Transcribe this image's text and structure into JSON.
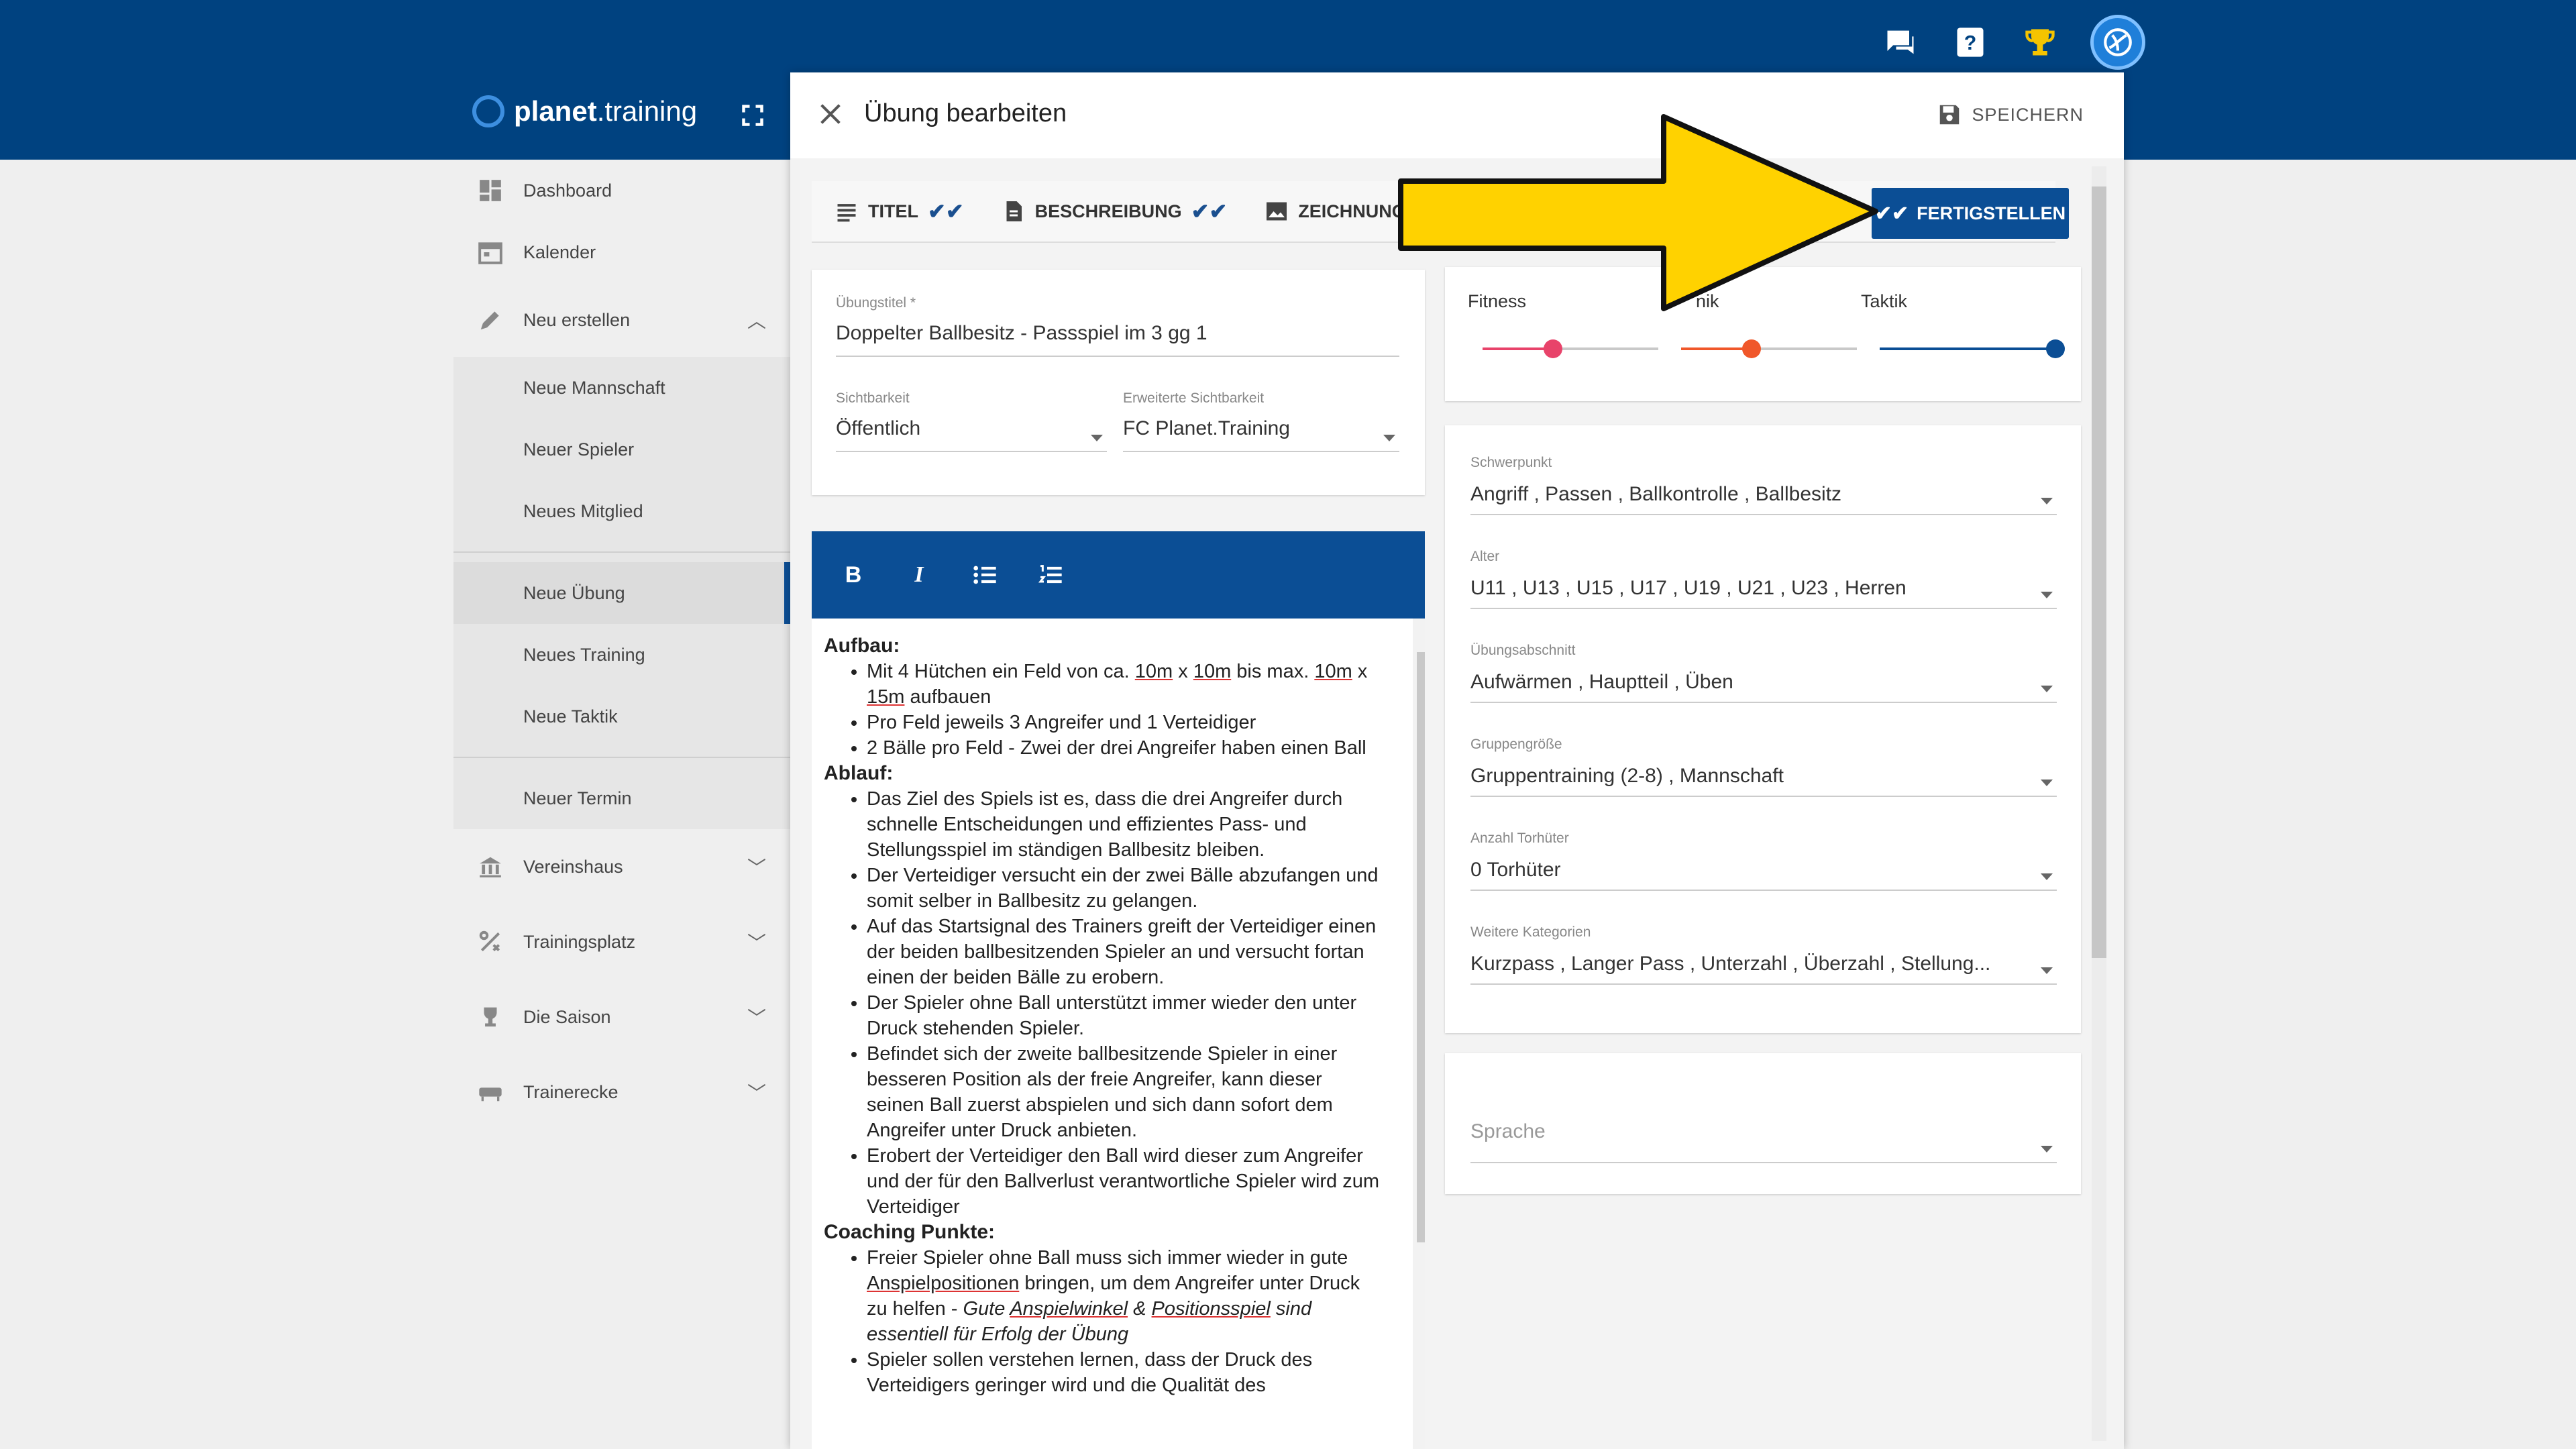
{
  "app": {
    "brand_prefix": "planet",
    "brand_suffix": ".training"
  },
  "topbar": {
    "icons": [
      "chat-icon",
      "help-icon",
      "trophy-icon",
      "avatar"
    ]
  },
  "sidebar": {
    "items": [
      {
        "label": "Dashboard",
        "icon": "dashboard-icon"
      },
      {
        "label": "Kalender",
        "icon": "calendar-icon"
      },
      {
        "label": "Neu erstellen",
        "icon": "pencil-icon",
        "expanded": true
      }
    ],
    "sub_group1": [
      "Neue Mannschaft",
      "Neuer Spieler",
      "Neues Mitglied"
    ],
    "sub_group2": [
      "Neue Übung",
      "Neues Training",
      "Neue Taktik"
    ],
    "sub_group3": [
      "Neuer Termin"
    ],
    "active_sub": "Neue Übung",
    "more_items": [
      {
        "label": "Vereinshaus",
        "icon": "building-icon"
      },
      {
        "label": "Trainingsplatz",
        "icon": "field-icon"
      },
      {
        "label": "Die Saison",
        "icon": "trophy-cup-icon"
      },
      {
        "label": "Trainerecke",
        "icon": "bench-icon"
      }
    ]
  },
  "dialog": {
    "title": "Übung bearbeiten",
    "save_label": "SPEICHERN",
    "tabs": [
      {
        "label": "TITEL",
        "icon": "list-icon"
      },
      {
        "label": "BESCHREIBUNG",
        "icon": "document-icon"
      },
      {
        "label": "ZEICHNUNG",
        "icon": "image-icon"
      }
    ],
    "finish_label": "FERTIGSTELLEN"
  },
  "form": {
    "title_label": "Übungstitel *",
    "title_value": "Doppelter Ballbesitz - Passspiel im 3 gg 1",
    "visibility_label": "Sichtbarkeit",
    "visibility_value": "Öffentlich",
    "ext_visibility_label": "Erweiterte Sichtbarkeit",
    "ext_visibility_value": "FC Planet.Training"
  },
  "sliders": {
    "fitness_label": "Fitness",
    "fitness_value": 0.4,
    "fitness_color": "#e8436a",
    "technik_label": "Technik",
    "technik_visible_label": "nik",
    "technik_value": 0.4,
    "technik_color": "#f0572a",
    "taktik_label": "Taktik",
    "taktik_value": 1.0,
    "taktik_color": "#0b4e95"
  },
  "selects": {
    "schwerpunkt_label": "Schwerpunkt",
    "schwerpunkt_value": "Angriff , Passen , Ballkontrolle , Ballbesitz",
    "alter_label": "Alter",
    "alter_value": "U11 , U13 , U15 , U17 , U19 , U21 , U23 , Herren",
    "abschnitt_label": "Übungsabschnitt",
    "abschnitt_value": "Aufwärmen , Hauptteil , Üben",
    "gruppe_label": "Gruppengröße",
    "gruppe_value": "Gruppentraining (2-8) , Mannschaft",
    "torhueter_label": "Anzahl Torhüter",
    "torhueter_value": "0 Torhüter",
    "kategorien_label": "Weitere Kategorien",
    "kategorien_value": "Kurzpass , Langer Pass , Unterzahl , Überzahl , Stellung...",
    "sprache_placeholder": "Sprache"
  },
  "editor": {
    "toolbar": {
      "bold": "B",
      "italic": "I"
    },
    "aufbau_heading": "Aufbau:",
    "ablauf_heading": "Ablauf:",
    "coaching_heading": "Coaching Punkte:",
    "aufbau": {
      "a1": "Mit 4 Hütchen ein Feld von ca. ",
      "a1_m1": "10m",
      "a1_x1": " x ",
      "a1_m2": "10m",
      "a1_b": " bis max. ",
      "a1_m3": "10m",
      "a1_x2": " x ",
      "a1_m4": "15m",
      "a1_end": " aufbauen",
      "a2": "Pro Feld jeweils 3 Angreifer und 1 Verteidiger",
      "a3": "2 Bälle pro Feld - Zwei der drei Angreifer haben einen Ball"
    },
    "ablauf": [
      "Das Ziel des Spiels ist es, dass die drei Angreifer durch schnelle Entscheidungen und effizientes Pass- und Stellungsspiel im ständigen Ballbesitz bleiben.",
      "Der Verteidiger versucht ein der zwei Bälle abzufangen und somit selber in Ballbesitz zu gelangen.",
      "Auf das Startsignal des Trainers greift der Verteidiger einen der beiden ballbesitzenden Spieler an und versucht fortan einen der beiden Bälle zu erobern.",
      "Der Spieler ohne Ball unterstützt immer wieder den unter Druck stehenden Spieler.",
      "Befindet sich der zweite ballbesitzende Spieler in einer besseren Position als der freie Angreifer, kann dieser seinen Ball zuerst abspielen und sich dann sofort dem Angreifer unter Druck anbieten.",
      "Erobert der Verteidiger den Ball wird dieser zum Angreifer und der für den Ballverlust verantwortliche Spieler wird zum Verteidiger"
    ],
    "coaching": {
      "c1_a": "Freier Spieler ohne Ball muss sich immer wieder in gute ",
      "c1_u1": "Anspielpositionen",
      "c1_b": " bringen, um dem Angreifer unter Druck zu helfen - ",
      "c1_i1": "Gute ",
      "c1_u2": "Anspielwinkel",
      "c1_i2": " & ",
      "c1_u3": "Positionsspiel",
      "c1_i3": " sind essentiell für Erfolg der Übung",
      "c2": "Spieler sollen verstehen lernen, dass der Druck des Verteidigers geringer wird und die Qualität des"
    }
  },
  "colors": {
    "primary": "#004280",
    "accent": "#0b4e95",
    "arrow": "#ffd200"
  }
}
